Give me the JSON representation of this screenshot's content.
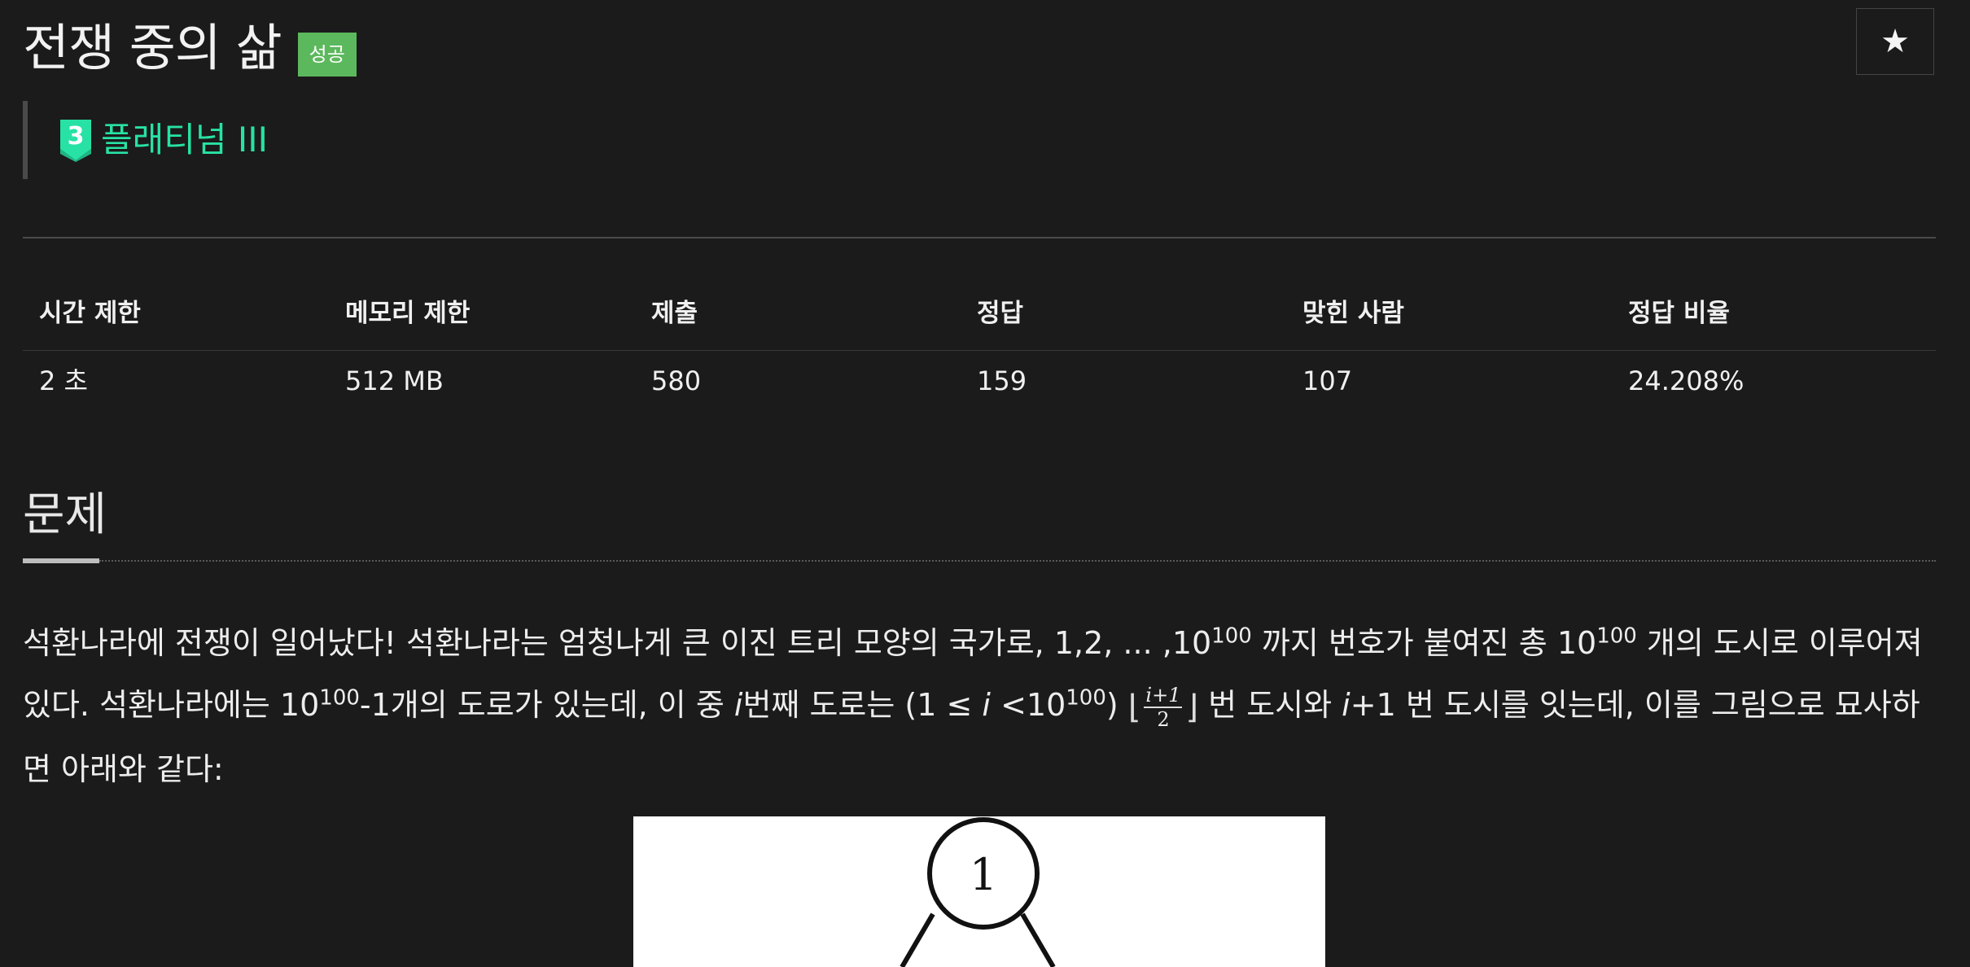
{
  "problem": {
    "title": "전쟁 중의 삶",
    "status_badge": "성공",
    "star_glyph": "★",
    "tier": {
      "level_number": "3",
      "label": "플래티넘 III",
      "color": "#27e2a4"
    }
  },
  "stats": {
    "headers": [
      "시간 제한",
      "메모리 제한",
      "제출",
      "정답",
      "맞힌 사람",
      "정답 비율"
    ],
    "values": [
      "2 초",
      "512 MB",
      "580",
      "159",
      "107",
      "24.208%"
    ]
  },
  "section": {
    "title": "문제"
  },
  "description": {
    "p1_a": "석환나라에 전쟁이 일어났다! 석환나라는 엄청나게 큰 이진 트리 모양의 국가로, 1,2, ... ,10",
    "exp": "100",
    "p1_b": " 까지 번호가 붙여진 총 10",
    "p1_c": " 개의 도시로 이루어져 있다. 석환나라에는 10",
    "p1_d": "-1개의 도로가 있는데, 이 중 ",
    "var_i": "i",
    "p1_e": "번째 도로는 (1 ≤ ",
    "p1_f": " <10",
    "p1_g": ") ",
    "floor_left": "⌊",
    "frac_num": "i+1",
    "frac_den": "2",
    "floor_right": "⌋",
    "p1_h": " 번 도시와 ",
    "p1_i": "+1 번 도시를 잇는데, 이를 그림으로 묘사하면 아래와 같다:"
  },
  "diagram": {
    "root_label": "1"
  }
}
